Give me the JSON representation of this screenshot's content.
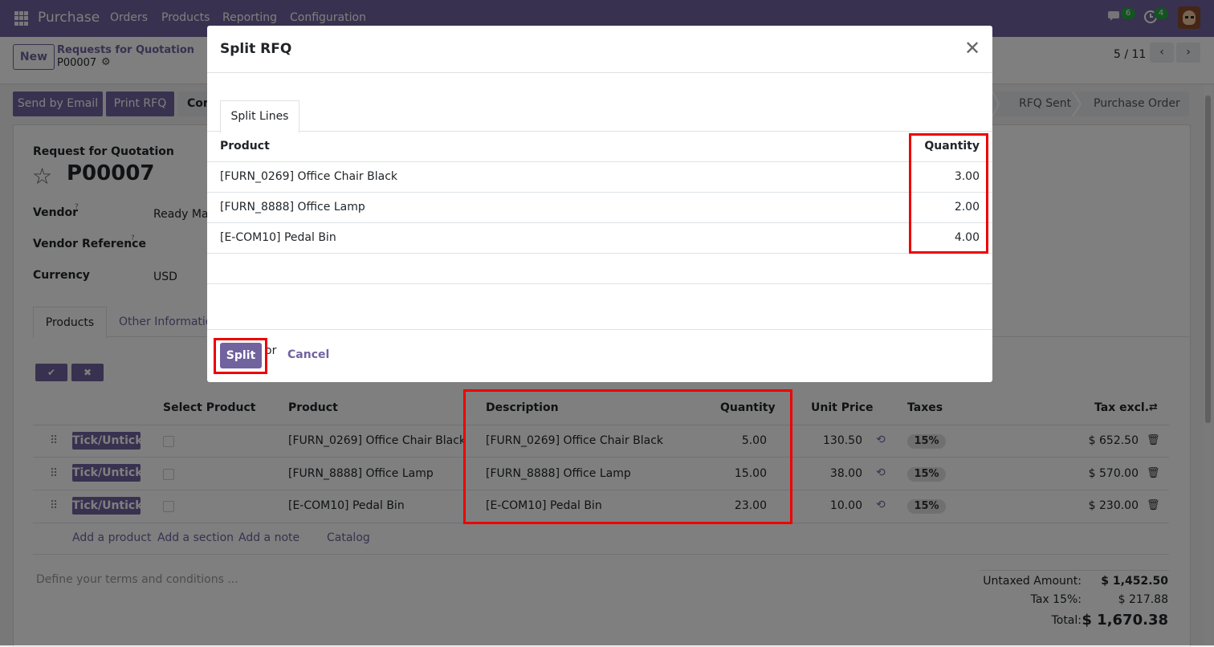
{
  "navbar": {
    "brand": "Purchase",
    "menu": [
      "Orders",
      "Products",
      "Reporting",
      "Configuration"
    ],
    "chat_count": "6",
    "activity_count": "4",
    "icons": [
      "apps-grid-icon",
      "chat-icon",
      "clock-icon"
    ]
  },
  "control_panel": {
    "new_label": "New",
    "breadcrumb_parent": "Requests for Quotation",
    "breadcrumb_current": "P00007",
    "pager": "5 / 11"
  },
  "statusbar": {
    "buttons": [
      "Send by Email",
      "Print RFQ"
    ],
    "confirm_partial": "Con",
    "stages": [
      "RFQ Sent",
      "Purchase Order"
    ]
  },
  "form": {
    "doc_label": "Request for Quotation",
    "title": "P00007",
    "vendor_label": "Vendor",
    "vendor_value": "Ready Mat",
    "vendor_ref_label": "Vendor Reference",
    "currency_label": "Currency",
    "currency_value": "USD",
    "help_marker": "?"
  },
  "notebook": {
    "tabs": [
      "Products",
      "Other Information"
    ]
  },
  "order_lines": {
    "headers": [
      "Select Product",
      "Product",
      "Description",
      "Quantity",
      "Unit Price",
      "Taxes",
      "Tax excl."
    ],
    "tick_label": "Tick/Untick",
    "rows": [
      {
        "product": "[FURN_0269] Office Chair Black",
        "description": "[FURN_0269] Office Chair Black",
        "quantity": "5.00",
        "unit_price": "130.50",
        "tax": "15%",
        "subtotal": "$ 652.50"
      },
      {
        "product": "[FURN_8888] Office Lamp",
        "description": "[FURN_8888] Office Lamp",
        "quantity": "15.00",
        "unit_price": "38.00",
        "tax": "15%",
        "subtotal": "$ 570.00"
      },
      {
        "product": "[E-COM10] Pedal Bin",
        "description": "[E-COM10] Pedal Bin",
        "quantity": "23.00",
        "unit_price": "10.00",
        "tax": "15%",
        "subtotal": "$ 230.00"
      }
    ],
    "add_links": [
      "Add a product",
      "Add a section",
      "Add a note",
      "Catalog"
    ]
  },
  "footer": {
    "terms_placeholder": "Define your terms and conditions ...",
    "untaxed_label": "Untaxed Amount:",
    "untaxed_value": "$ 1,452.50",
    "tax_label": "Tax 15%:",
    "tax_value": "$ 217.88",
    "total_label": "Total:",
    "total_value": "$ 1,670.38"
  },
  "modal": {
    "title": "Split RFQ",
    "tab": "Split Lines",
    "col_product": "Product",
    "col_quantity": "Quantity",
    "lines": [
      {
        "product": "[FURN_0269] Office Chair Black",
        "quantity": "3.00"
      },
      {
        "product": "[FURN_8888] Office Lamp",
        "quantity": "2.00"
      },
      {
        "product": "[E-COM10] Pedal Bin",
        "quantity": "4.00"
      }
    ],
    "split_label": "Split",
    "or_label": "or",
    "cancel_label": "Cancel"
  },
  "colors": {
    "brand": "#71639e",
    "highlight": "#ee0000",
    "badge": "#28a745"
  }
}
